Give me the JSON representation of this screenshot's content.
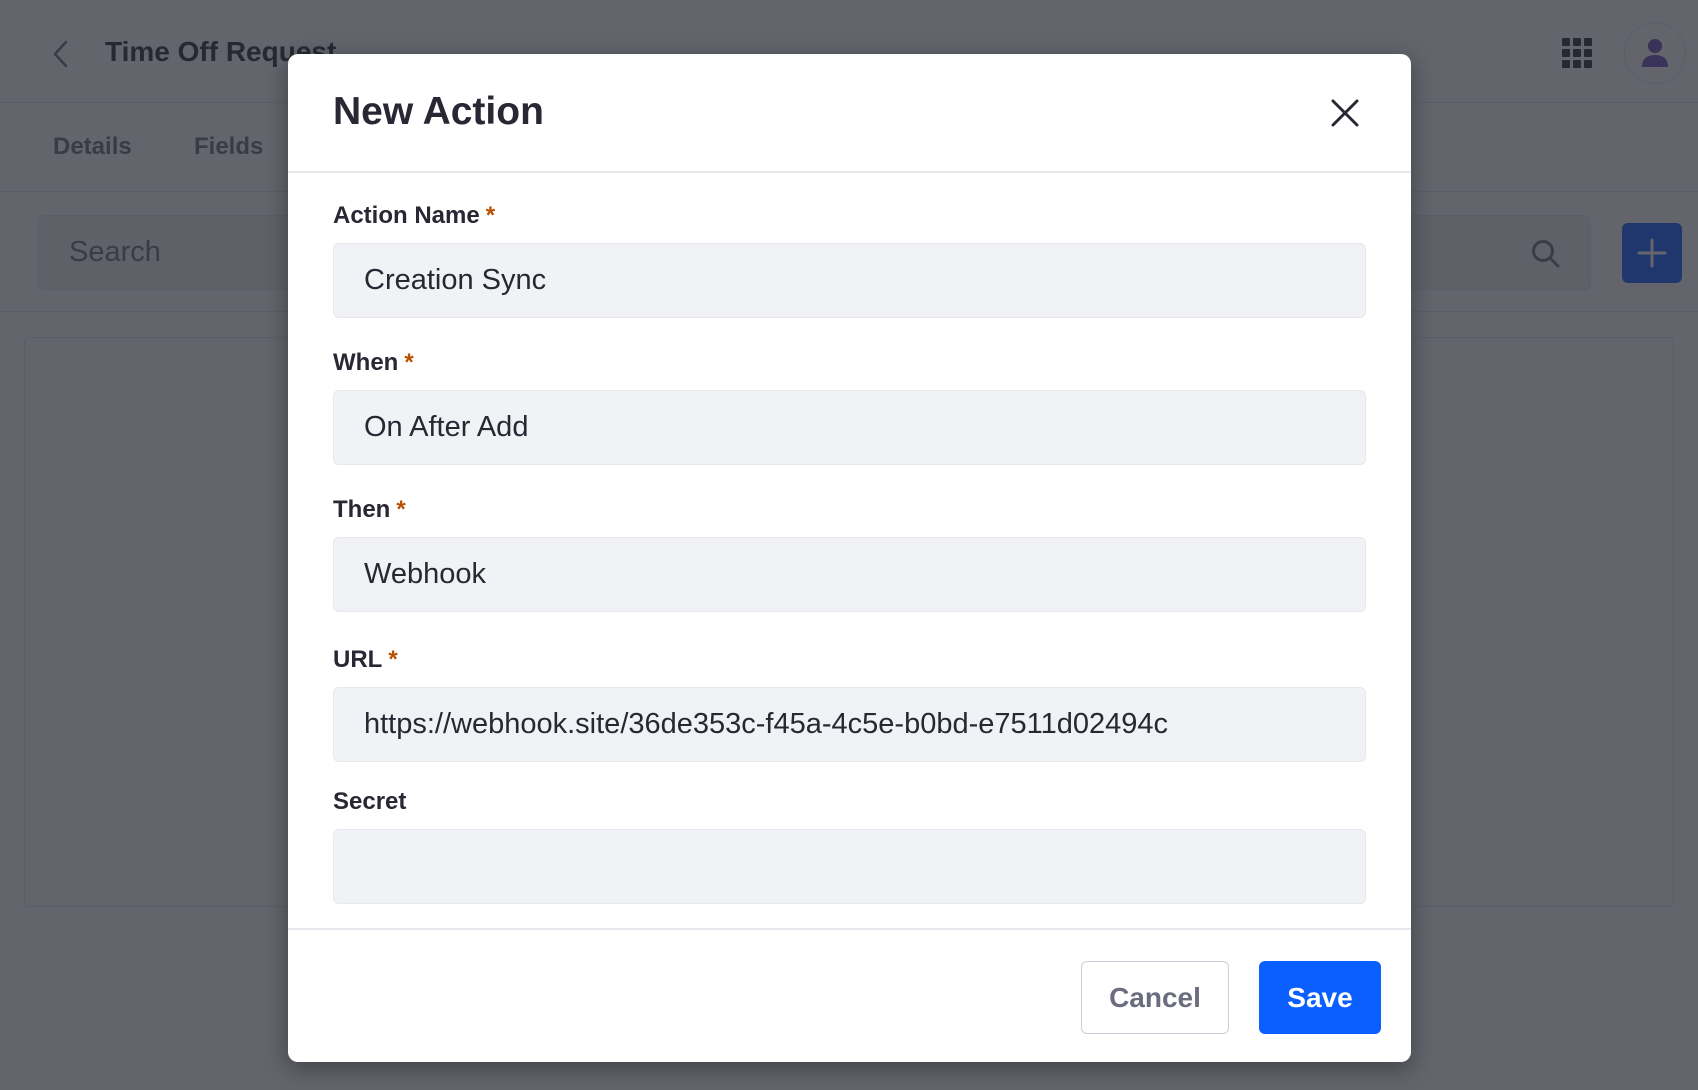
{
  "page": {
    "title": "Time Off Request",
    "tabs": [
      {
        "label": "Details"
      },
      {
        "label": "Fields"
      }
    ],
    "search": {
      "placeholder": "Search"
    },
    "icons": {
      "back": "chevron-left-icon",
      "apps": "apps-grid-icon",
      "avatar": "user-icon",
      "search": "search-icon",
      "add": "plus-icon"
    }
  },
  "modal": {
    "title": "New Action",
    "close_icon": "close-icon",
    "required_mark": "*",
    "fields": [
      {
        "label": "Action Name",
        "required": true,
        "value": "Creation Sync"
      },
      {
        "label": "When",
        "required": true,
        "value": "On After Add"
      },
      {
        "label": "Then",
        "required": true,
        "value": "Webhook"
      },
      {
        "label": "URL",
        "required": true,
        "value": "https://webhook.site/36de353c-f45a-4c5e-b0bd-e7511d02494c"
      },
      {
        "label": "Secret",
        "required": false,
        "value": ""
      }
    ],
    "footer": {
      "cancel_label": "Cancel",
      "save_label": "Save"
    }
  },
  "colors": {
    "primary": "#0b5fff",
    "required": "#b95000",
    "text": "#272833",
    "input_bg": "#f1f2f5"
  }
}
